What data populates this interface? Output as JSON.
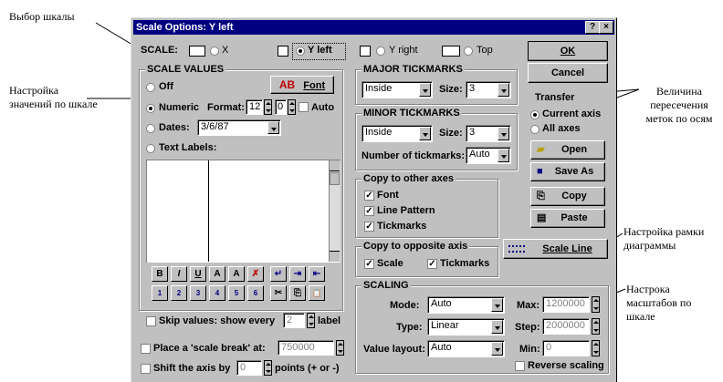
{
  "annotations": {
    "scale_select": "Выбор шкалы",
    "scale_values_1": "Настройка",
    "scale_values_2": "значений по шкале",
    "tick_1": "Величина",
    "tick_2": "пересечения",
    "tick_3": "меток по осям",
    "frame_1": "Настройка рамки",
    "frame_2": "диаграммы",
    "scaling_1": "Настрока",
    "scaling_2": "масштабов по",
    "scaling_3": "шкале"
  },
  "dialog": {
    "title": "Scale Options:  Y left",
    "help_btn": "?",
    "close_btn": "×",
    "scale_label": "SCALE:",
    "scale_options": {
      "x": "X",
      "y_left": "Y left",
      "y_right": "Y right",
      "top": "Top"
    }
  },
  "scale_values": {
    "title": "SCALE VALUES",
    "off": "Off",
    "font_btn": "Font",
    "font_icon_text": "AB",
    "numeric": "Numeric",
    "format_label": "Format:",
    "format_value": "12",
    "decimals_value": "0",
    "auto": "Auto",
    "dates": "Dates:",
    "dates_value": "3/6/87",
    "text_labels": "Text Labels:",
    "skip_label": "Skip values: show every",
    "skip_value": "2",
    "skip_suffix": "label"
  },
  "toolbar_icons": [
    "B",
    "I",
    "U",
    "A",
    "A",
    "✗",
    "↵",
    "⇥",
    "⇤",
    "1",
    "2",
    "3",
    "4",
    "5",
    "6",
    "✂",
    "⎘",
    "📋"
  ],
  "scale_break": {
    "label": "Place a 'scale break' at:",
    "value": "750000"
  },
  "shift": {
    "label": "Shift the axis by",
    "value": "0",
    "suffix": "points (+ or -)"
  },
  "major": {
    "title": "MAJOR TICKMARKS",
    "type": "Inside",
    "size_label": "Size:",
    "size": "3"
  },
  "minor": {
    "title": "MINOR TICKMARKS",
    "type": "Inside",
    "size_label": "Size:",
    "size": "3",
    "number_label": "Number of tickmarks:",
    "number": "Auto"
  },
  "copy_other": {
    "title": "Copy to other axes",
    "font": "Font",
    "line_pattern": "Line Pattern",
    "tickmarks": "Tickmarks"
  },
  "copy_opposite": {
    "title": "Copy to opposite axis",
    "scale": "Scale",
    "tickmarks": "Tickmarks"
  },
  "buttons": {
    "ok": "OK",
    "cancel": "Cancel",
    "transfer": "Transfer",
    "current_axis": "Current axis",
    "all_axes": "All axes",
    "open": "Open",
    "save_as": "Save As",
    "copy": "Copy",
    "paste": "Paste",
    "scale_line": "Scale Line"
  },
  "scaling": {
    "title": "SCALING",
    "mode_label": "Mode:",
    "mode": "Auto",
    "type_label": "Type:",
    "type": "Linear",
    "layout_label": "Value layout:",
    "layout": "Auto",
    "max_label": "Max:",
    "max": "1200000",
    "step_label": "Step:",
    "step": "2000000",
    "min_label": "Min:",
    "min": "0",
    "reverse": "Reverse scaling"
  }
}
